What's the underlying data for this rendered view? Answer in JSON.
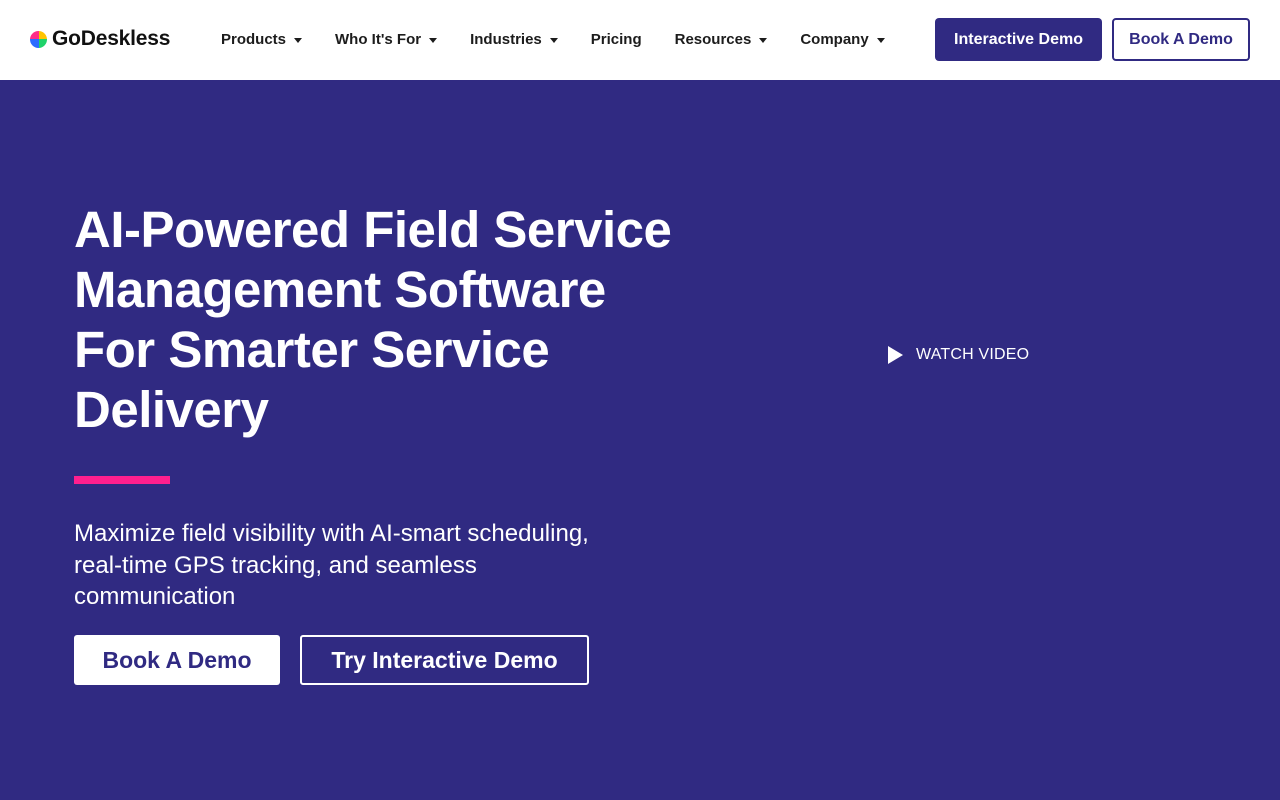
{
  "header": {
    "logo_text": "GoDeskless",
    "nav": [
      {
        "label": "Products",
        "has_dropdown": true
      },
      {
        "label": "Who It's For",
        "has_dropdown": true
      },
      {
        "label": "Industries",
        "has_dropdown": true
      },
      {
        "label": "Pricing",
        "has_dropdown": false
      },
      {
        "label": "Resources",
        "has_dropdown": true
      },
      {
        "label": "Company",
        "has_dropdown": true
      }
    ],
    "interactive_demo_label": "Interactive Demo",
    "book_demo_label": "Book A Demo"
  },
  "hero": {
    "title": "AI-Powered Field Service Management Software For Smarter Service Delivery",
    "subtitle": "Maximize field visibility with AI-smart scheduling, real-time GPS tracking, and seamless communication",
    "primary_button": "Book A Demo",
    "secondary_button": "Try Interactive Demo",
    "watch_video_label": "WATCH VIDEO"
  },
  "icons": {
    "logo": "logo-icon",
    "dropdown": "chevron-down-icon",
    "video": "play-icon"
  },
  "colors": {
    "brand": "#302a82",
    "accent": "#ff1f8e",
    "background_header": "#ffffff",
    "text_dark": "#1c1c1c"
  }
}
